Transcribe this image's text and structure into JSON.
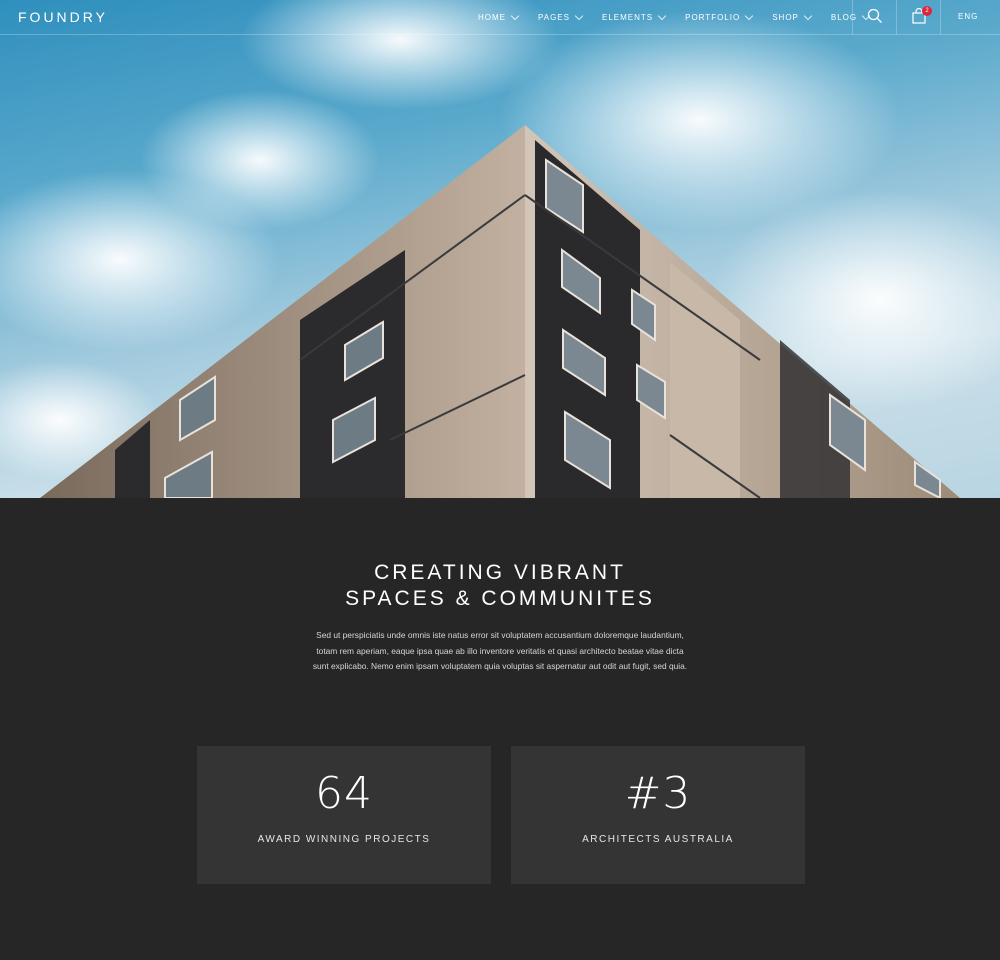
{
  "brand": {
    "logo": "FOUNDRY"
  },
  "nav": {
    "items": [
      {
        "label": "HOME"
      },
      {
        "label": "PAGES"
      },
      {
        "label": "ELEMENTS"
      },
      {
        "label": "PORTFOLIO"
      },
      {
        "label": "SHOP"
      },
      {
        "label": "BLOG"
      }
    ],
    "cart_count": "2",
    "language": "ENG",
    "icons": [
      "search-icon",
      "shopping-bag-icon",
      "chevron-down-icon"
    ]
  },
  "main": {
    "headline_line1": "CREATING VIBRANT",
    "headline_line2": "SPACES & COMMUNITES",
    "body": "Sed ut perspiciatis unde omnis iste natus error sit voluptatem accusantium doloremque laudantium, totam rem aperiam, eaque ipsa quae ab illo inventore veritatis et quasi architecto beatae vitae dicta sunt explicabo. Nemo enim ipsam voluptatem quia voluptas sit aspernatur aut odit aut fugit, sed quia."
  },
  "stats": [
    {
      "value": "64",
      "label": "AWARD WINNING PROJECTS"
    },
    {
      "value": "#3",
      "label": "ARCHITECTS AUSTRALIA"
    }
  ],
  "colors": {
    "background": "#262626",
    "card": "#343434",
    "badge": "#e0233c",
    "sky": "#5aa9cc"
  }
}
